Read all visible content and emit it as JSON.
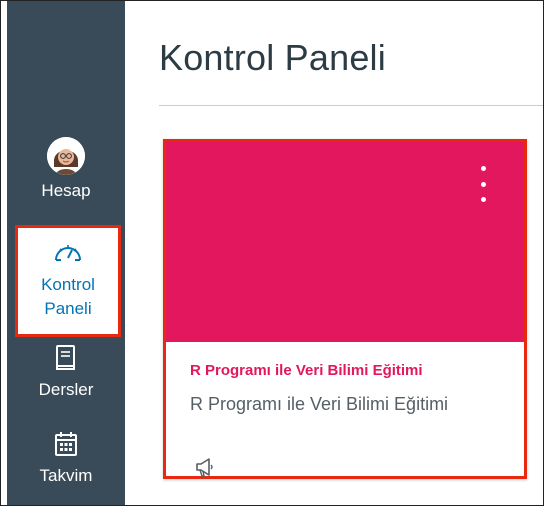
{
  "sidebar": {
    "account": {
      "label": "Hesap",
      "icon": "avatar-icon"
    },
    "dashboard": {
      "label_line1": "Kontrol",
      "label_line2": "Paneli",
      "icon": "dashboard-gauge-icon",
      "active": true
    },
    "courses": {
      "label": "Dersler",
      "icon": "book-icon"
    },
    "calendar": {
      "label": "Takvim",
      "icon": "calendar-icon"
    }
  },
  "header": {
    "title": "Kontrol Paneli"
  },
  "course_card": {
    "hero_color": "#e3175e",
    "link_title": "R Programı ile Veri Bilimi Eğitimi",
    "subtitle": "R Programı ile Veri Bilimi Eğitimi",
    "action_icon": "announcement-icon",
    "menu_icon": "kebab-menu-icon"
  },
  "colors": {
    "sidebar_bg": "#394b58",
    "accent": "#0374b5",
    "highlight_border": "#e8290f"
  }
}
